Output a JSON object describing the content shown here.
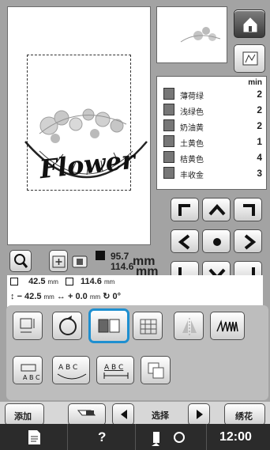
{
  "canvas": {
    "design_text": "Flower"
  },
  "threads": {
    "min_header": "min",
    "items": [
      {
        "name": "薄荷绿",
        "minutes": "2",
        "color": "#7a7a7a"
      },
      {
        "name": "浅绿色",
        "minutes": "2",
        "color": "#8a8a8a"
      },
      {
        "name": "奶油黄",
        "minutes": "2",
        "color": "#9a9a9a"
      },
      {
        "name": "土黄色",
        "minutes": "1",
        "color": "#6e6e6e"
      },
      {
        "name": "桔黄色",
        "minutes": "4",
        "color": "#7e7e7e"
      },
      {
        "name": "丰收金",
        "minutes": "3",
        "color": "#858585"
      }
    ]
  },
  "info": {
    "height": "95.7",
    "width": "114.6",
    "unit": "mm",
    "pos_v": "42.5",
    "pos_h": "114.6",
    "offset_v": "− 42.5",
    "offset_h": "+ 0.0",
    "angle": "0°"
  },
  "bottom": {
    "add_label": "添加",
    "select_label": "选择",
    "embroider_label": "绣花"
  },
  "status": {
    "help_icon": "?",
    "time": "12:00"
  }
}
